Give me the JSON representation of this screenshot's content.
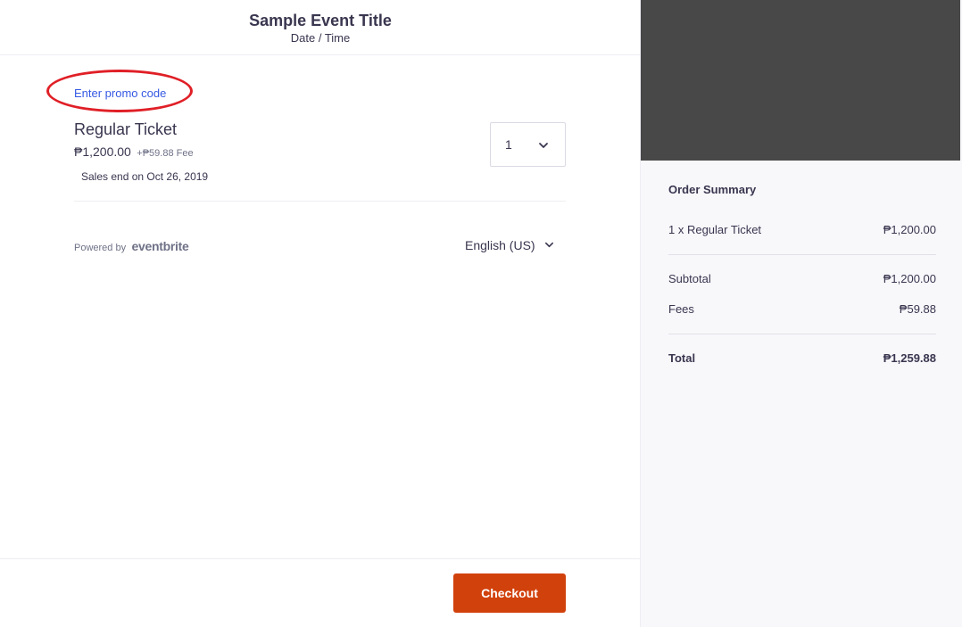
{
  "header": {
    "event_title": "Sample Event Title",
    "event_datetime": "Date / Time"
  },
  "promo": {
    "link_label": "Enter promo code",
    "highlight_color": "#e01f26"
  },
  "ticket": {
    "name": "Regular Ticket",
    "price": "₱1,200.00",
    "fee": "+₱59.88 Fee",
    "sales_end": "Sales end on Oct 26, 2019",
    "quantity_selected": "1",
    "quantity_chevron_icon": "chevron-down-icon"
  },
  "footer_meta": {
    "powered_by": "Powered by",
    "brand": "eventbrite",
    "language": "English (US)",
    "language_chevron_icon": "chevron-down-icon"
  },
  "actions": {
    "checkout_label": "Checkout",
    "checkout_color": "#d1410c"
  },
  "order_summary": {
    "title": "Order Summary",
    "line_items": [
      {
        "label": "1 x Regular Ticket",
        "value": "₱1,200.00"
      }
    ],
    "subtotal": {
      "label": "Subtotal",
      "value": "₱1,200.00"
    },
    "fees": {
      "label": "Fees",
      "value": "₱59.88"
    },
    "total": {
      "label": "Total",
      "value": "₱1,259.88"
    }
  },
  "colors": {
    "link": "#3659e3",
    "text": "#39364f",
    "image_placeholder": "#484848",
    "summary_background": "#f8f7fa"
  }
}
